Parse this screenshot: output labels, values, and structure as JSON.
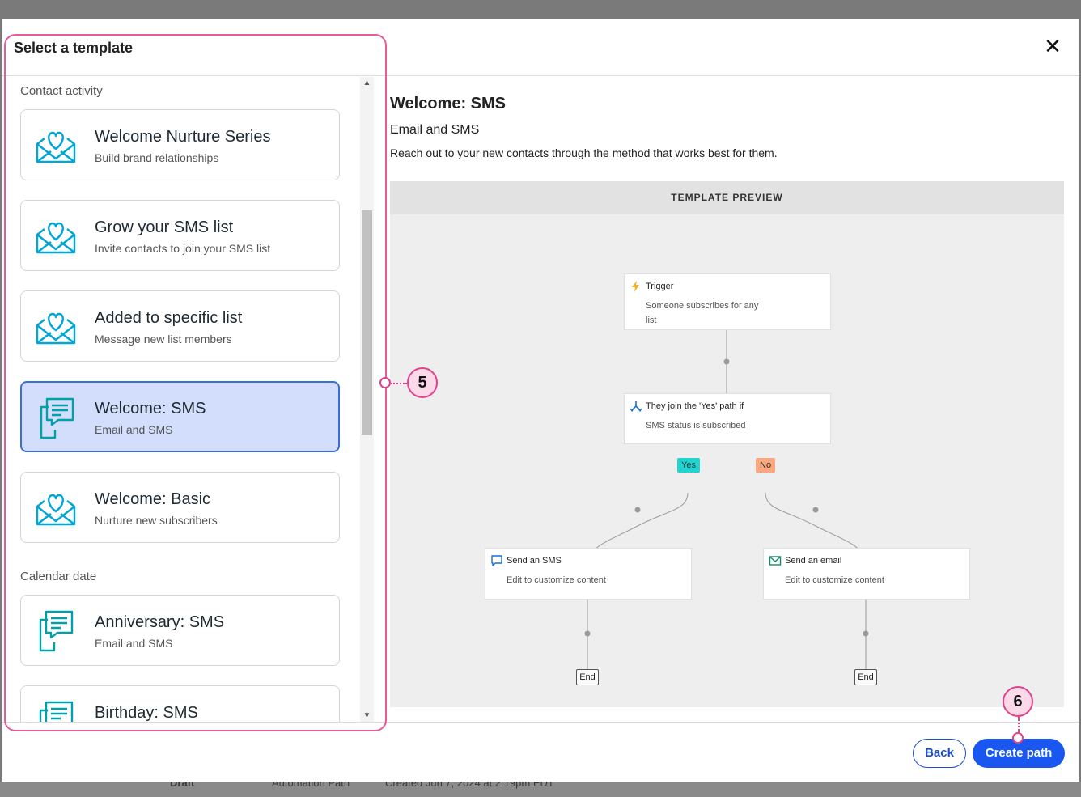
{
  "modal": {
    "title": "Select a template",
    "close_label": "✕"
  },
  "template_list": {
    "sections": [
      {
        "label": "Contact activity",
        "cards": [
          {
            "title": "Welcome Nurture Series",
            "subtitle": "Build brand relationships",
            "icon": "envelope-heart-icon",
            "selected": false
          },
          {
            "title": "Grow your SMS list",
            "subtitle": "Invite contacts to join your SMS list",
            "icon": "envelope-heart-icon",
            "selected": false
          },
          {
            "title": "Added to specific list",
            "subtitle": "Message new list members",
            "icon": "envelope-heart-icon",
            "selected": false
          },
          {
            "title": "Welcome: SMS",
            "subtitle": "Email and SMS",
            "icon": "phone-chat-icon",
            "selected": true
          },
          {
            "title": "Welcome: Basic",
            "subtitle": "Nurture new subscribers",
            "icon": "envelope-heart-icon",
            "selected": false
          }
        ]
      },
      {
        "label": "Calendar date",
        "cards": [
          {
            "title": "Anniversary: SMS",
            "subtitle": "Email and SMS",
            "icon": "phone-chat-icon",
            "selected": false
          },
          {
            "title": "Birthday: SMS",
            "subtitle": "",
            "icon": "phone-chat-icon",
            "selected": false
          }
        ]
      }
    ]
  },
  "detail": {
    "title": "Welcome: SMS",
    "subtitle": "Email and SMS",
    "description": "Reach out to your new contacts through the method that works best for them."
  },
  "preview": {
    "header": "TEMPLATE PREVIEW",
    "trigger": {
      "title": "Trigger",
      "line1": "Someone subscribes for any",
      "line2": "list"
    },
    "condition": {
      "title": "They join the 'Yes' path if",
      "subtitle": "SMS status is subscribed"
    },
    "yes_label": "Yes",
    "no_label": "No",
    "sms_step": {
      "title": "Send an SMS",
      "subtitle": "Edit to customize content"
    },
    "email_step": {
      "title": "Send an email",
      "subtitle": "Edit to customize content"
    },
    "end_label": "End"
  },
  "footer": {
    "back_label": "Back",
    "create_label": "Create path"
  },
  "callouts": {
    "list_number": "5",
    "create_number": "6"
  },
  "backdrop": {
    "status": "Draft",
    "type": "Automation Path",
    "created": "Created Jun 7, 2024 at 2:19pm EDT"
  },
  "colors": {
    "accent": "#1a56f0",
    "selected_bg": "#d2defc",
    "icon_teal": "#00a6d6",
    "callout_pink": "#e2428c",
    "yes_tag": "#22d4cf",
    "no_tag": "#f8a982"
  }
}
